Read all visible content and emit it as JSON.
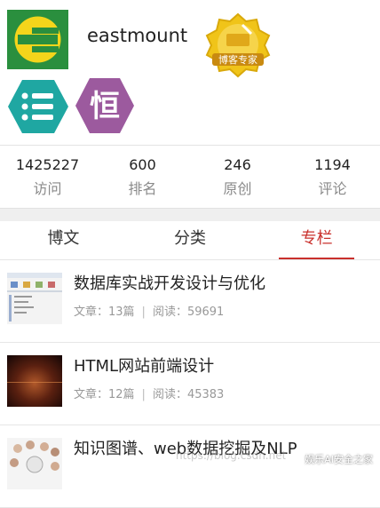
{
  "profile": {
    "username": "eastmount",
    "expert_badge_text": "博客专家",
    "heng_badge_text": "恒"
  },
  "stats": [
    {
      "value": "1425227",
      "label": "访问"
    },
    {
      "value": "600",
      "label": "排名"
    },
    {
      "value": "246",
      "label": "原创"
    },
    {
      "value": "1194",
      "label": "评论"
    }
  ],
  "tabs": [
    {
      "label": "博文",
      "active": false
    },
    {
      "label": "分类",
      "active": false
    },
    {
      "label": "专栏",
      "active": true
    }
  ],
  "articles": [
    {
      "title": "数据库实战开发设计与优化",
      "count_label": "文章：13篇",
      "reads_label": "阅读：59691"
    },
    {
      "title": "HTML网站前端设计",
      "count_label": "文章：12篇",
      "reads_label": "阅读：45383"
    },
    {
      "title": "知识图谱、web数据挖掘及NLP",
      "count_label": "",
      "reads_label": ""
    }
  ],
  "watermark": "https://blog.csdn.net",
  "wechat_label": "娱乐AI安全之家",
  "colors": {
    "accent": "#c9302c",
    "heng_purple": "#9c5a9e",
    "list_teal": "#1fa7a2",
    "avatar_green": "#1e8a3a",
    "avatar_yellow": "#f2d21a"
  }
}
